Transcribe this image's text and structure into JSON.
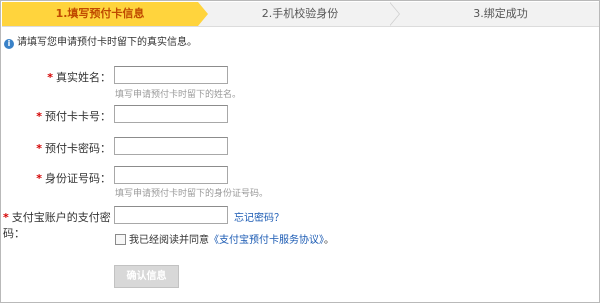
{
  "steps": {
    "step1": "1.填写预付卡信息",
    "step2": "2.手机校验身份",
    "step3": "3.绑定成功"
  },
  "notice": "请填写您申请预付卡时留下的真实信息。",
  "form": {
    "required_mark": "*",
    "real_name_label": "真实姓名：",
    "real_name_hint": "填写申请预付卡时留下的姓名。",
    "card_number_label": "预付卡卡号：",
    "card_password_label": "预付卡密码：",
    "id_number_label": "身份证号码：",
    "id_number_hint": "填写申请预付卡时留下的身份证号码。",
    "alipay_password_label": "支付宝账户的支付密码：",
    "forgot_password_link": "忘记密码？",
    "agree_prefix": "我已经阅读并同意",
    "agree_link": "《支付宝预付卡服务协议》",
    "agree_suffix": "。",
    "submit_label": "确认信息"
  },
  "colors": {
    "active_step_bg": "#ffd43d",
    "active_step_text": "#c04a00",
    "required": "#d40000",
    "link": "#1a5ab3",
    "info_icon": "#3a82c8",
    "disabled_button": "#d8d8d8"
  }
}
